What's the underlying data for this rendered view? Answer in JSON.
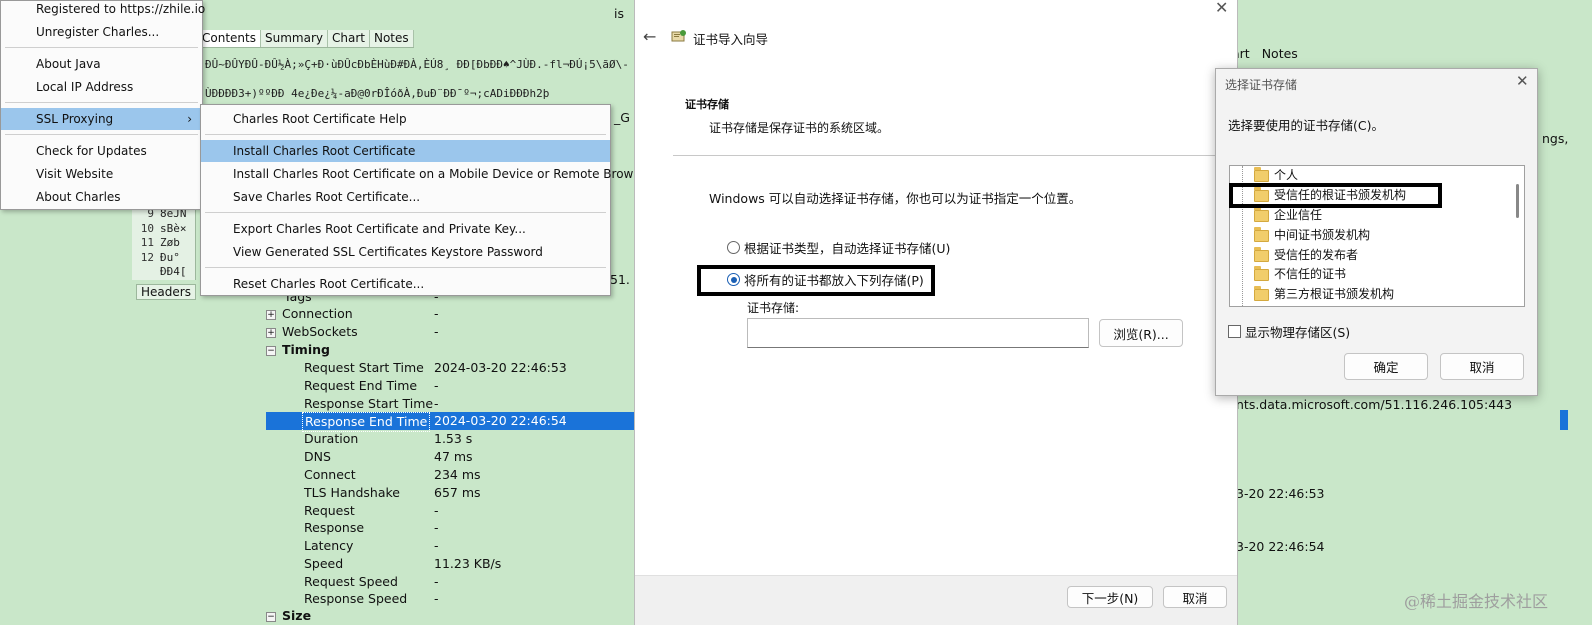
{
  "charles": {
    "tabs": [
      "Contents",
      "Summary",
      "Chart",
      "Notes"
    ],
    "hex_lines": [
      "ÐÛ~ÐÛYÐÛ-ÐÛ½À;»Ç+Ð·ùÐÛcÐbÈHùÐ#ÐÀ,ÈÚ8¸ ÐÐ[ÐbÐÐ♠^JÙÐ.-fl¬ÐÚ¡5\\ãØ\\-¯_AE",
      "ÙÐÐÐÐ3+)ººÐÐ 4e¿Ðe¿¼-aÐ@0rÐÎóðÀ,ÐuÐ¨ÐÐ¯º¬;cADiÐÐÐh2þ"
    ],
    "rows": [
      {
        "n": "9",
        "v": "8eJN"
      },
      {
        "n": "10",
        "v": "sBè×"
      },
      {
        "n": "11",
        "v": "Zøb "
      },
      {
        "n": "12",
        "v": "Ðu°"
      },
      {
        "n": "",
        "v": "ÐÐ4["
      }
    ],
    "headers_tab": "Headers",
    "side_text_1": "is",
    "side_text_2": "_G",
    "side_text_3": "51.",
    "tree": {
      "tags": {
        "label": "Tags",
        "value": "-"
      },
      "connection": {
        "label": "Connection",
        "value": "-"
      },
      "websockets": {
        "label": "WebSockets",
        "value": "-"
      },
      "timing": {
        "label": "Timing"
      },
      "items": [
        {
          "label": "Request Start Time",
          "value": "2024-03-20 22:46:53"
        },
        {
          "label": "Request End Time",
          "value": "-"
        },
        {
          "label": "Response Start Time",
          "value": "-"
        },
        {
          "label": "Response End Time",
          "value": "2024-03-20 22:46:54"
        },
        {
          "label": "Duration",
          "value": "1.53 s"
        },
        {
          "label": "DNS",
          "value": "47 ms"
        },
        {
          "label": "Connect",
          "value": "234 ms"
        },
        {
          "label": "TLS Handshake",
          "value": "657 ms"
        },
        {
          "label": "Request",
          "value": "-"
        },
        {
          "label": "Response",
          "value": "-"
        },
        {
          "label": "Latency",
          "value": "-"
        },
        {
          "label": "Speed",
          "value": "11.23 KB/s"
        },
        {
          "label": "Request Speed",
          "value": "-"
        },
        {
          "label": "Response Speed",
          "value": "-"
        }
      ],
      "size": {
        "label": "Size"
      }
    },
    "right": {
      "tabs": [
        "art",
        "Notes"
      ],
      "ngs": "ngs,",
      "host": "nts.data.microsoft.com/51.116.246.105:443",
      "time1": "3-20 22:46:53",
      "time2": "3-20 22:46:54"
    }
  },
  "menu": {
    "items": [
      "Registered to https://zhile.io",
      "Unregister Charles...",
      "About Java",
      "Local IP Address",
      "SSL Proxying",
      "Check for Updates",
      "Visit Website",
      "About Charles"
    ],
    "arrow": "›"
  },
  "submenu": {
    "items": [
      "Charles Root Certificate Help",
      "Install Charles Root Certificate",
      "Install Charles Root Certificate on a Mobile Device or Remote Browser",
      "Save Charles Root Certificate...",
      "Export Charles Root Certificate and Private Key...",
      "View Generated SSL Certificates Keystore Password",
      "Reset Charles Root Certificate..."
    ]
  },
  "wizard": {
    "title": "证书导入向导",
    "back": "←",
    "close": "✕",
    "section_title": "证书存储",
    "section_desc": "证书存储是保存证书的系统区域。",
    "intro": "Windows 可以自动选择证书存储，你也可以为证书指定一个位置。",
    "radio_auto": "根据证书类型，自动选择证书存储(U)",
    "radio_manual": "将所有的证书都放入下列存储(P)",
    "store_label": "证书存储:",
    "store_value": "",
    "browse_button": "浏览(R)...",
    "next_button": "下一步(N)",
    "cancel_button": "取消"
  },
  "store_dialog": {
    "title": "选择证书存储",
    "close": "✕",
    "prompt": "选择要使用的证书存储(C)。",
    "stores": [
      "个人",
      "受信任的根证书颁发机构",
      "企业信任",
      "中间证书颁发机构",
      "受信任的发布者",
      "不信任的证书",
      "第三方根证书颁发机构"
    ],
    "show_physical": "显示物理存储区(S)",
    "ok_button": "确定",
    "cancel_button": "取消"
  },
  "watermark": "@稀土掘金技术社区"
}
